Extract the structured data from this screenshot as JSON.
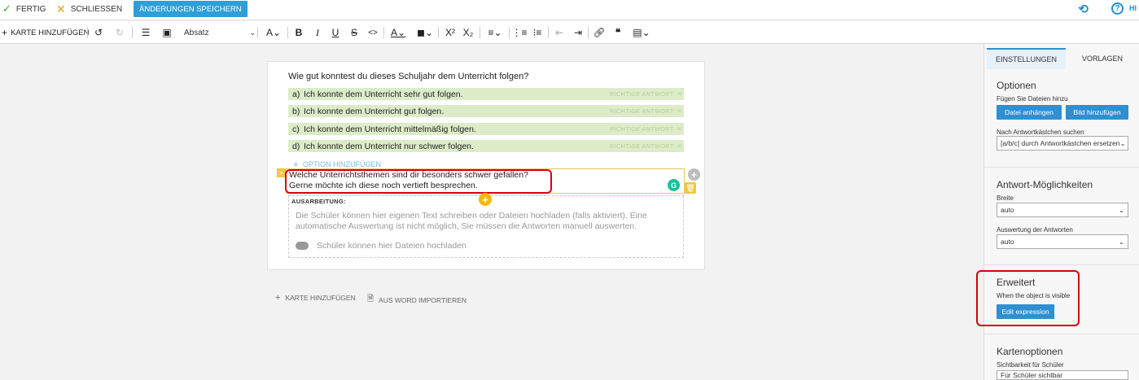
{
  "topbar": {
    "fertig": "FERTIG",
    "schliessen": "SCHLIESSEN",
    "save": "ÄNDERUNGEN SPEICHERN",
    "hilfe": "HI"
  },
  "toolbar": {
    "add_card": "KARTE HINZUFÜGEN",
    "paragraph_style": "Absatz"
  },
  "question": {
    "text": "Wie gut konntest du dieses Schuljahr dem Unterricht folgen?",
    "options": [
      {
        "letter": "a)",
        "text": "Ich konnte dem Unterricht sehr gut folgen.",
        "tag": "RICHTIGE ANTWORT"
      },
      {
        "letter": "b)",
        "text": "Ich konnte dem Unterricht gut folgen.",
        "tag": "RICHTIGE ANTWORT"
      },
      {
        "letter": "c)",
        "text": "Ich konnte dem Unterricht mittelmäßig folgen.",
        "tag": "RICHTIGE ANTWORT"
      },
      {
        "letter": "d)",
        "text": "Ich konnte dem Unterricht nur schwer folgen.",
        "tag": "RICHTIGE ANTWORT"
      }
    ],
    "add_option": "OPTION HINZUFÜGEN"
  },
  "text_block": {
    "line1": "Welche Unterrichtsthemen sind dir besonders schwer gefallen?",
    "line2": "Gerne möchte ich diese noch vertieft besprechen."
  },
  "answer": {
    "heading": "AUSARBEITUNG:",
    "description": "Die Schüler können hier eigenen Text schreiben oder Dateien hochladen (falls aktiviert). Eine automatische Auswertung ist nicht möglich, Sie müssen die Antworten manuell auswerten.",
    "upload": "Schüler können hier Dateien hochladen"
  },
  "bottom": {
    "add_card": "KARTE HINZUFÜGEN",
    "import_word": "AUS WORD IMPORTIEREN"
  },
  "panel": {
    "tab_settings": "EINSTELLUNGEN",
    "tab_templates": "VORLAGEN",
    "options_title": "Optionen",
    "options_sub": "Fügen Sie Dateien hinzu",
    "attach_file": "Datei anhängen",
    "add_image": "Bild hinzufügen",
    "search_label": "Nach Antwortkästchen suchen",
    "search_value": "[a/b/c] durch Antwortkästchen ersetzen",
    "answer_title": "Antwort-Möglichkeiten",
    "width_label": "Breite",
    "width_value": "auto",
    "eval_label": "Auswertung der Antworten",
    "eval_value": "auto",
    "advanced_title": "Erweitert",
    "advanced_sub": "When the object is visible",
    "edit_expression": "Edit expression",
    "card_title": "Kartenoptionen",
    "visibility_label": "Sichtbarkeit für Schüler",
    "visibility_value": "Für Schüler sichtbar"
  },
  "colors": {
    "accent": "#2f8fd0",
    "option_bg": "#dcecc9",
    "highlight": "#d8000c",
    "handle": "#f2c640"
  }
}
